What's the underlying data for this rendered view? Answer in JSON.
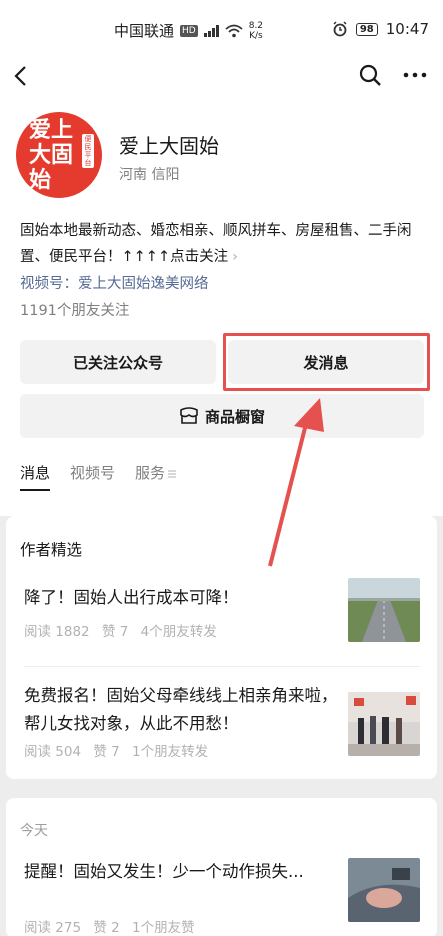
{
  "status_bar": {
    "carrier": "中国联通",
    "hd": "HD",
    "network": "5G",
    "speed_value": "8.2",
    "speed_unit": "K/s",
    "battery": "98",
    "time": "10:47"
  },
  "account": {
    "avatar_line1": "爱上",
    "avatar_line2": "大固始",
    "avatar_tag": "便民平台",
    "name": "爱上大固始",
    "location": "河南 信阳",
    "description": "固始本地最新动态、婚恋相亲、顺风拼车、房屋租售、二手闲置、便民平台！↑↑↑↑点击关注",
    "video_label": "视频号：爱上大固始逸美网络",
    "friends_following": "1191个朋友关注"
  },
  "buttons": {
    "followed": "已关注公众号",
    "send_message": "发消息",
    "shop_window": "商品橱窗"
  },
  "tabs": [
    {
      "label": "消息",
      "active": true
    },
    {
      "label": "视频号",
      "active": false
    },
    {
      "label": "服务",
      "active": false
    }
  ],
  "featured": {
    "title": "作者精选",
    "articles": [
      {
        "title": "降了！固始人出行成本可降！",
        "reads": "阅读 1882",
        "likes": "赞 7",
        "shares": "4个朋友转发"
      },
      {
        "title": "免费报名！固始父母牵线线上相亲角来啦，帮儿女找对象，从此不用愁！",
        "reads": "阅读 504",
        "likes": "赞 7",
        "shares": "1个朋友转发"
      }
    ]
  },
  "today": {
    "title": "今天",
    "articles": [
      {
        "title": "提醒！固始又发生！少一个动作损失...",
        "reads": "阅读 275",
        "likes": "赞 2",
        "shares": "1个朋友赞"
      }
    ]
  },
  "colors": {
    "accent_link": "#576b95",
    "annotation_red": "#e5514f",
    "avatar_red": "#e43b2e"
  }
}
